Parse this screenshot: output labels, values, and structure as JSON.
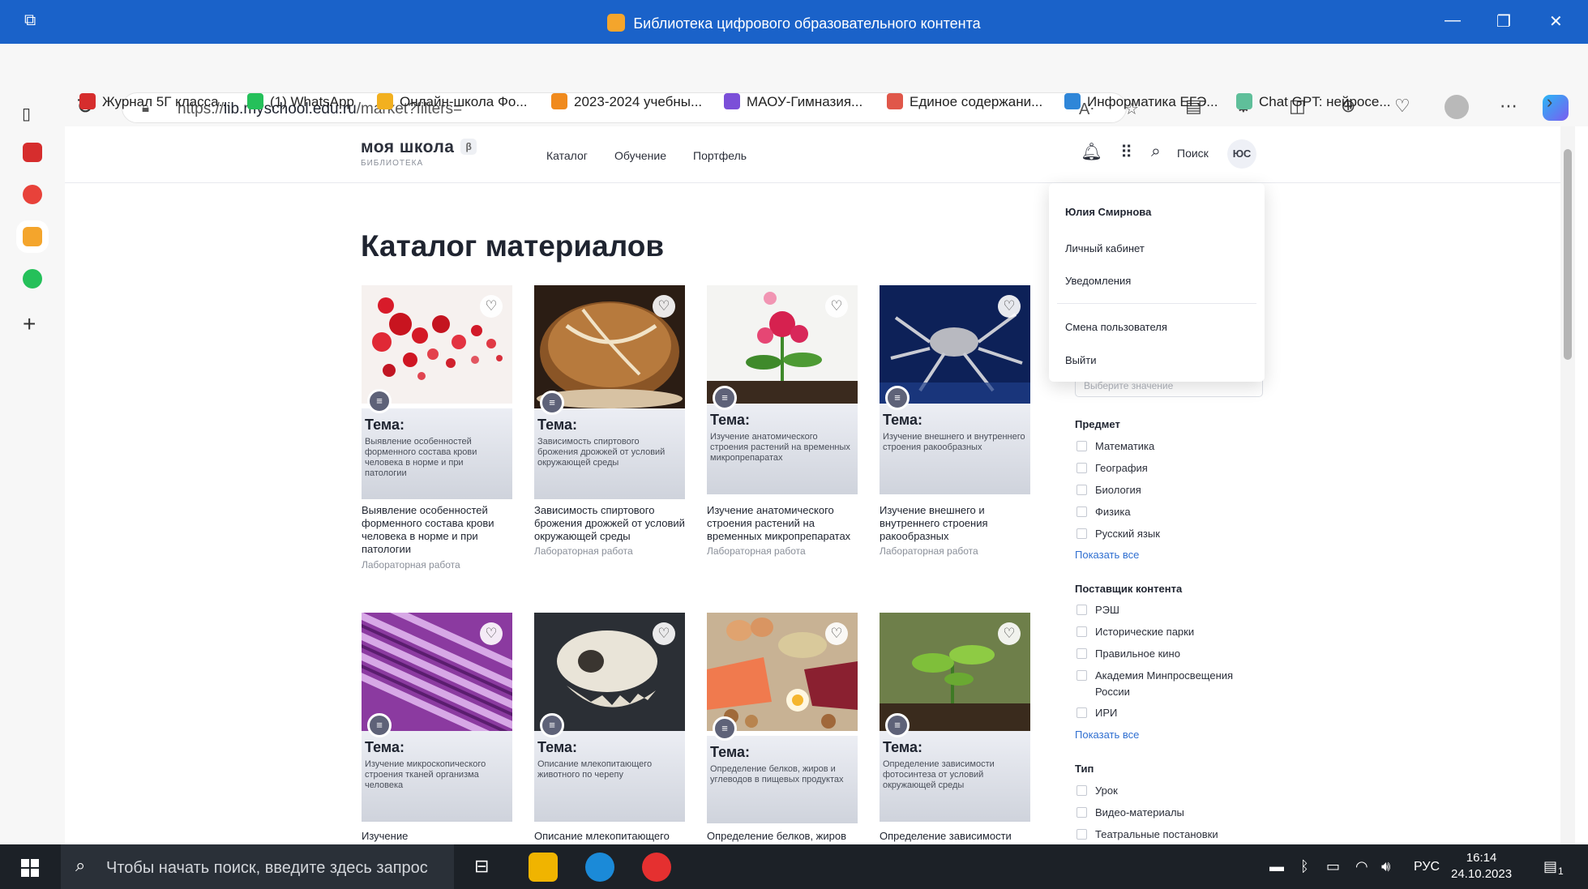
{
  "browser": {
    "window_title": "Библиотека цифрового образовательного контента",
    "url_prefix": "https://",
    "url_domain": "lib.myschool.edu.ru",
    "url_path": "/market?filters=",
    "bookmarks": [
      {
        "label": "Журнал 5Г класса...",
        "color": "#d62d2d"
      },
      {
        "label": "(1) WhatsApp",
        "color": "#25c05a"
      },
      {
        "label": "Онлайн-школа Фо...",
        "color": "#f2b01f"
      },
      {
        "label": "2023-2024 учебны...",
        "color": "#f08a1d"
      },
      {
        "label": "МАОУ-Гимназия...",
        "color": "#7b4fd8"
      },
      {
        "label": "Единое содержани...",
        "color": "#e0574a"
      },
      {
        "label": "Информатика ЕГЭ...",
        "color": "#2f86d8"
      },
      {
        "label": "Chat GPT: нейросе...",
        "color": "#5fbf9a"
      }
    ]
  },
  "site": {
    "logo": "моя школа",
    "logo_badge": "β",
    "logo_sub": "БИБЛИОТЕКА",
    "nav": [
      "Каталог",
      "Обучение",
      "Портфель"
    ],
    "search_label": "Поиск",
    "avatar_initials": "ЮС"
  },
  "user_menu": {
    "name": "Юлия Смирнова",
    "items": [
      "Личный кабинет",
      "Уведомления"
    ],
    "items2": [
      "Смена пользователя",
      "Выйти"
    ]
  },
  "catalog": {
    "title": "Каталог материалов",
    "topic_label": "Тема:",
    "type_label": "Лабораторная работа",
    "cards": [
      {
        "subtitle": "Выявление особенностей форменного состава крови человека в норме и при патологии",
        "title": "Выявление особенностей форменного состава крови человека в норме и при патологии",
        "type": "Лабораторная работа"
      },
      {
        "subtitle": "Зависимость спиртового брожения дрожжей от условий окружающей среды",
        "title": "Зависимость спиртового брожения дрожжей от условий окружающей среды",
        "type": "Лабораторная работа"
      },
      {
        "subtitle": "Изучение анатомического строения растений на временных микропрепаратах",
        "title": "Изучение анатомического строения растений на временных микропрепаратах",
        "type": "Лабораторная работа"
      },
      {
        "subtitle": "Изучение внешнего и внутреннего строения ракообразных",
        "title": "Изучение внешнего и внутреннего строения ракообразных",
        "type": "Лабораторная работа"
      },
      {
        "subtitle": "Изучение микроскопического строения тканей организма человека",
        "title": "Изучение",
        "type": ""
      },
      {
        "subtitle": "Описание млекопитающего животного по черепу",
        "title": "Описание млекопитающего",
        "type": ""
      },
      {
        "subtitle": "Определение белков, жиров и углеводов в пищевых продуктах",
        "title": "Определение белков, жиров",
        "type": ""
      },
      {
        "subtitle": "Определение зависимости фотосинтеза от условий окружающей среды",
        "title": "Определение зависимости",
        "type": ""
      }
    ]
  },
  "filters": {
    "select_placeholder": "Выберите значение",
    "subject_head": "Предмет",
    "subjects": [
      "Математика",
      "География",
      "Биология",
      "Физика",
      "Русский язык"
    ],
    "show_all": "Показать все",
    "provider_head": "Поставщик контента",
    "providers": [
      "РЭШ",
      "Исторические парки",
      "Правильное кино",
      "Академия Минпросвещения",
      "ИРИ"
    ],
    "provider_wrap": "России",
    "type_head": "Тип",
    "types": [
      "Урок",
      "Видео-материалы",
      "Театральные постановки"
    ]
  },
  "taskbar": {
    "search_placeholder": "Чтобы начать поиск, введите здесь запрос",
    "lang": "РУС",
    "time": "16:14",
    "date": "24.10.2023",
    "notif_count": "1"
  }
}
